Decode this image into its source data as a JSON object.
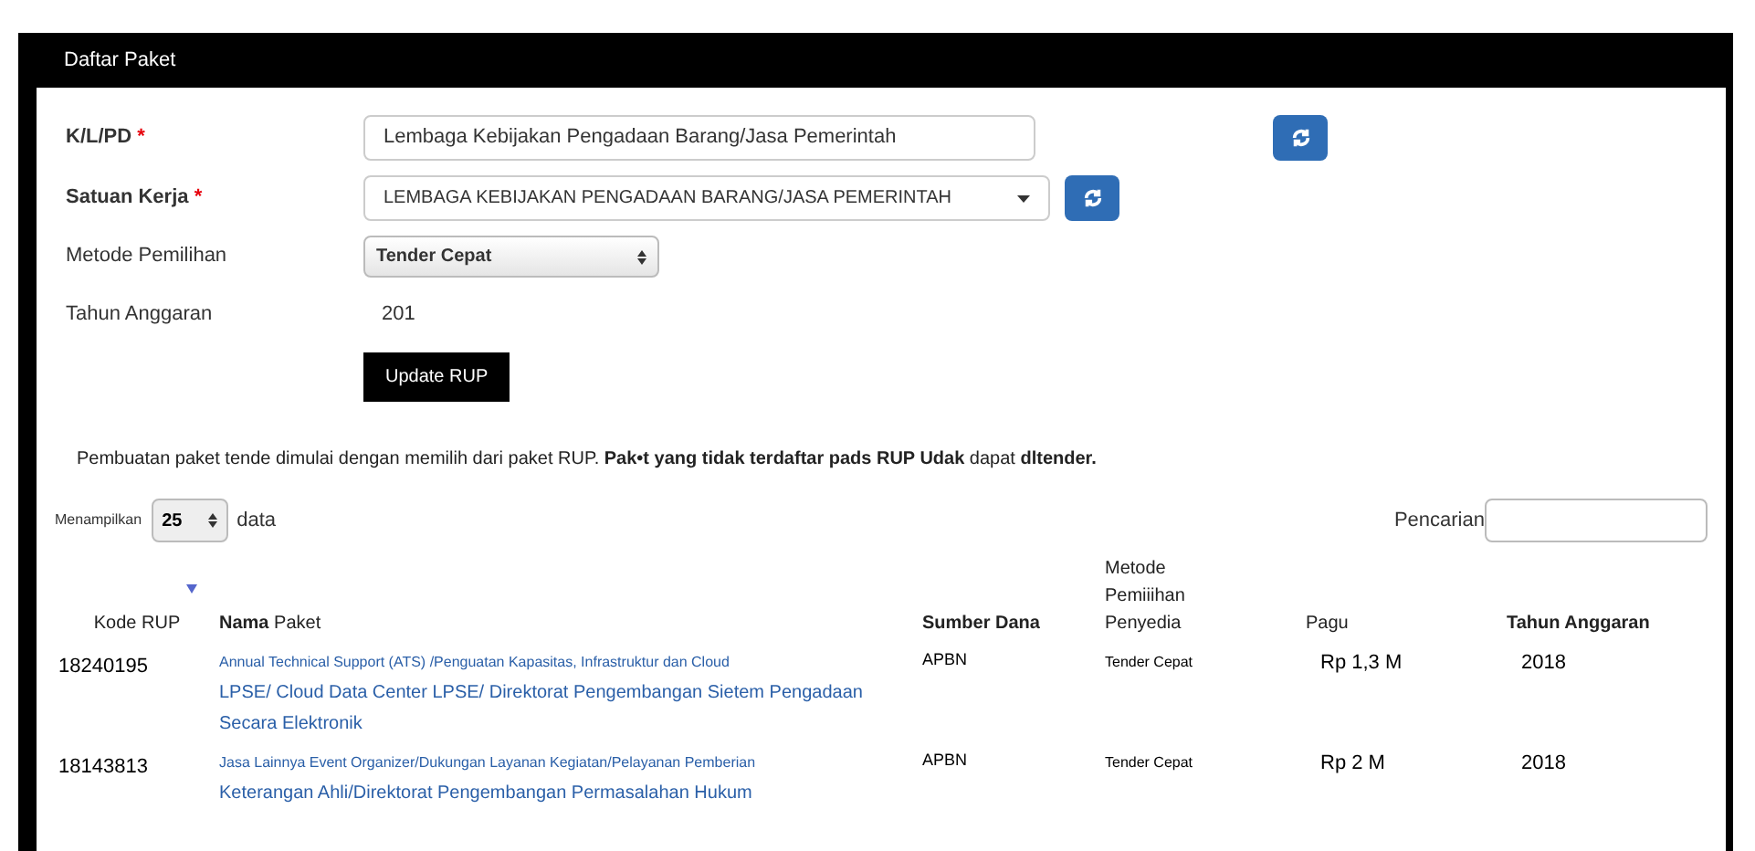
{
  "header": {
    "title": "Daftar Paket"
  },
  "form": {
    "klpd": {
      "label": "K/L/PD",
      "marker": "*",
      "value": "Lembaga Kebijakan Pengadaan Barang/Jasa Pemerintah"
    },
    "satker": {
      "label": "Satuan Kerja",
      "marker": "*",
      "value": "LEMBAGA KEBIJAKAN PENGADAAN BARANG/JASA PEMERINTAH"
    },
    "metode": {
      "label": "Metode Pemilihan",
      "value": "Tender Cepat"
    },
    "tahun": {
      "label": "Tahun Anggaran",
      "value": "201"
    },
    "update_button": "Update RUP"
  },
  "notice": "Pembuatan paket tende dimulai dengan memilih dari paket RUP. **Pak•t yang tidak terdaftar pads RUP Udak** dapat **dltender.**",
  "length": {
    "prefix": "Menampilkan",
    "value": "25",
    "suffix": "data"
  },
  "search": {
    "label": "Pencarian"
  },
  "table": {
    "columns": [
      {
        "label": "Kode RUP",
        "sorted": false
      },
      {
        "label": "**Nama** Paket",
        "sorted": true
      },
      {
        "label": "Sumber Dana",
        "sorted": false
      },
      {
        "label": "Metode Pemiiihan Penyedia",
        "sorted": false
      },
      {
        "label": "Pagu",
        "sorted": false
      },
      {
        "label": "Tahun Anggaran",
        "sorted": false
      }
    ],
    "rows": [
      {
        "kode": "18240195",
        "nama_small": "Annual Technical Support (ATS) /Penguatan Kapasitas, Infrastruktur dan Cloud",
        "nama": "LPSE/ Cloud Data Center LPSE/ Direktorat Pengembangan Sietem Pengadaan Secara Elektronik",
        "sumber": "APBN",
        "metode": "Tender Cepat",
        "pagu": "Rp 1,3 M",
        "tahun": "2018"
      },
      {
        "kode": "18143813",
        "nama_small": "Jasa Lainnya Event Organizer/Dukungan Layanan Kegiatan/Pelayanan Pemberian",
        "nama": "Keterangan Ahli/Direktorat Pengembangan Permasalahan Hukum",
        "sumber": "APBN",
        "metode": "Tender Cepat",
        "pagu": "Rp 2 M",
        "tahun": "2018"
      }
    ]
  }
}
